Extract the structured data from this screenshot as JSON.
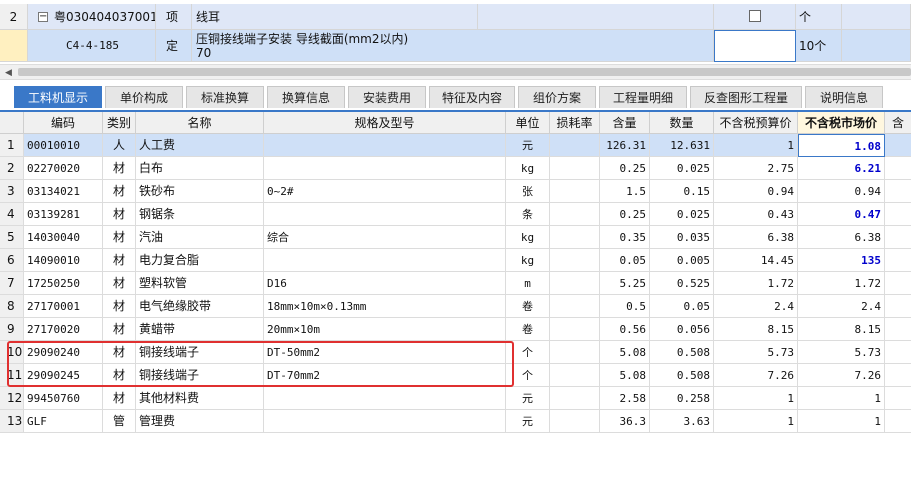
{
  "top_rows": [
    {
      "index": "2",
      "code": "粤030404037001",
      "type": "项",
      "name": "线耳",
      "unit": "个"
    },
    {
      "index": "",
      "code": "C4-4-185",
      "type": "定",
      "name_line1": "压铜接线端子安装 导线截面(mm2以内)",
      "name_line2": "70",
      "unit": "10个"
    }
  ],
  "tabs": [
    "工料机显示",
    "单价构成",
    "标准换算",
    "换算信息",
    "安装费用",
    "特征及内容",
    "组价方案",
    "工程量明细",
    "反查图形工程量",
    "说明信息"
  ],
  "columns": [
    "",
    "编码",
    "类别",
    "名称",
    "规格及型号",
    "单位",
    "损耗率",
    "含量",
    "数量",
    "不含税预算价",
    "不含税市场价",
    "含"
  ],
  "rows": [
    {
      "idx": "1",
      "code": "00010010",
      "cat": "人",
      "name": "人工费",
      "spec": "",
      "unit": "元",
      "loss": "",
      "qty": "126.31",
      "amount": "12.631",
      "budget": "1",
      "market": "1.08"
    },
    {
      "idx": "2",
      "code": "02270020",
      "cat": "材",
      "name": "白布",
      "spec": "",
      "unit": "kg",
      "loss": "",
      "qty": "0.25",
      "amount": "0.025",
      "budget": "2.75",
      "market": "6.21"
    },
    {
      "idx": "3",
      "code": "03134021",
      "cat": "材",
      "name": "铁砂布",
      "spec": "0~2#",
      "unit": "张",
      "loss": "",
      "qty": "1.5",
      "amount": "0.15",
      "budget": "0.94",
      "market": "0.94"
    },
    {
      "idx": "4",
      "code": "03139281",
      "cat": "材",
      "name": "钢锯条",
      "spec": "",
      "unit": "条",
      "loss": "",
      "qty": "0.25",
      "amount": "0.025",
      "budget": "0.43",
      "market": "0.47"
    },
    {
      "idx": "5",
      "code": "14030040",
      "cat": "材",
      "name": "汽油",
      "spec": "综合",
      "unit": "kg",
      "loss": "",
      "qty": "0.35",
      "amount": "0.035",
      "budget": "6.38",
      "market": "6.38"
    },
    {
      "idx": "6",
      "code": "14090010",
      "cat": "材",
      "name": "电力复合脂",
      "spec": "",
      "unit": "kg",
      "loss": "",
      "qty": "0.05",
      "amount": "0.005",
      "budget": "14.45",
      "market": "135"
    },
    {
      "idx": "7",
      "code": "17250250",
      "cat": "材",
      "name": "塑料软管",
      "spec": "D16",
      "unit": "m",
      "loss": "",
      "qty": "5.25",
      "amount": "0.525",
      "budget": "1.72",
      "market": "1.72"
    },
    {
      "idx": "8",
      "code": "27170001",
      "cat": "材",
      "name": "电气绝缘胶带",
      "spec": "18mm×10m×0.13mm",
      "unit": "卷",
      "loss": "",
      "qty": "0.5",
      "amount": "0.05",
      "budget": "2.4",
      "market": "2.4"
    },
    {
      "idx": "9",
      "code": "27170020",
      "cat": "材",
      "name": "黄蜡带",
      "spec": "20mm×10m",
      "unit": "卷",
      "loss": "",
      "qty": "0.56",
      "amount": "0.056",
      "budget": "8.15",
      "market": "8.15"
    },
    {
      "idx": "10",
      "code": "29090240",
      "cat": "材",
      "name": "铜接线端子",
      "spec": "DT-50mm2",
      "unit": "个",
      "loss": "",
      "qty": "5.08",
      "amount": "0.508",
      "budget": "5.73",
      "market": "5.73"
    },
    {
      "idx": "11",
      "code": "29090245",
      "cat": "材",
      "name": "铜接线端子",
      "spec": "DT-70mm2",
      "unit": "个",
      "loss": "",
      "qty": "5.08",
      "amount": "0.508",
      "budget": "7.26",
      "market": "7.26"
    },
    {
      "idx": "12",
      "code": "99450760",
      "cat": "材",
      "name": "其他材料费",
      "spec": "",
      "unit": "元",
      "loss": "",
      "qty": "2.58",
      "amount": "0.258",
      "budget": "1",
      "market": "1"
    },
    {
      "idx": "13",
      "code": "GLF",
      "cat": "管",
      "name": "管理费",
      "spec": "",
      "unit": "元",
      "loss": "",
      "qty": "36.3",
      "amount": "3.63",
      "budget": "1",
      "market": "1"
    }
  ],
  "colors": {
    "accent": "#3a78c8",
    "highlight_box": "#e03030",
    "blue_value": "#0000cc"
  }
}
